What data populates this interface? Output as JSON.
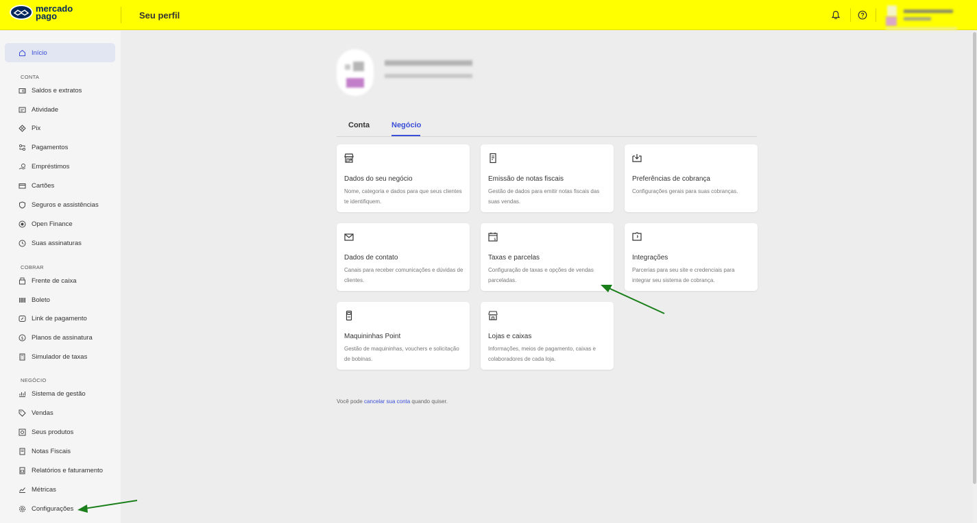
{
  "header": {
    "brand_line1": "mercado",
    "brand_line2": "pago",
    "title": "Seu perfil",
    "icons": [
      "bell-icon",
      "help-icon"
    ],
    "brand_color": "#ffff00"
  },
  "sidebar": {
    "home_label": "Início",
    "sections": [
      {
        "title": "CONTA",
        "items": [
          {
            "label": "Saldos e extratos",
            "icon": "wallet-icon"
          },
          {
            "label": "Atividade",
            "icon": "activity-icon"
          },
          {
            "label": "Pix",
            "icon": "pix-icon"
          },
          {
            "label": "Pagamentos",
            "icon": "payments-icon"
          },
          {
            "label": "Empréstimos",
            "icon": "loan-icon"
          },
          {
            "label": "Cartões",
            "icon": "card-icon"
          },
          {
            "label": "Seguros e assistências",
            "icon": "shield-icon"
          },
          {
            "label": "Open Finance",
            "icon": "open-finance-icon"
          },
          {
            "label": "Suas assinaturas",
            "icon": "subscription-icon"
          }
        ]
      },
      {
        "title": "COBRAR",
        "items": [
          {
            "label": "Frente de caixa",
            "icon": "cashier-icon"
          },
          {
            "label": "Boleto",
            "icon": "barcode-icon"
          },
          {
            "label": "Link de pagamento",
            "icon": "link-icon"
          },
          {
            "label": "Planos de assinatura",
            "icon": "plan-icon"
          },
          {
            "label": "Simulador de taxas",
            "icon": "calculator-icon"
          }
        ]
      },
      {
        "title": "NEGÓCIO",
        "items": [
          {
            "label": "Sistema de gestão",
            "icon": "management-icon"
          },
          {
            "label": "Vendas",
            "icon": "tag-icon"
          },
          {
            "label": "Seus produtos",
            "icon": "products-icon"
          },
          {
            "label": "Notas Fiscais",
            "icon": "invoice-icon"
          },
          {
            "label": "Relatórios e faturamento",
            "icon": "report-icon"
          },
          {
            "label": "Métricas",
            "icon": "metrics-icon"
          },
          {
            "label": "Configurações",
            "icon": "gear-icon"
          }
        ]
      }
    ]
  },
  "tabs": [
    {
      "label": "Conta",
      "active": false
    },
    {
      "label": "Negócio",
      "active": true
    }
  ],
  "cards": [
    {
      "title": "Dados do seu negócio",
      "desc": "Nome, categoria e dados para que seus clientes te identifiquem.",
      "icon": "store-icon"
    },
    {
      "title": "Emissão de notas fiscais",
      "desc": "Gestão de dados para emitir notas fiscais das suas vendas.",
      "icon": "receipt-icon"
    },
    {
      "title": "Preferências de cobrança",
      "desc": "Configurações gerais para suas cobranças.",
      "icon": "download-tray-icon"
    },
    {
      "title": "Dados de contato",
      "desc": "Canais para receber comunicações e dúvidas de clientes.",
      "icon": "envelope-icon"
    },
    {
      "title": "Taxas e parcelas",
      "desc": "Configuração de taxas e opções de vendas parceladas.",
      "icon": "calendar-money-icon"
    },
    {
      "title": "Integrações",
      "desc": "Parcerias para seu site e credenciais para integrar seu sistema de cobrança.",
      "icon": "puzzle-icon"
    },
    {
      "title": "Maquininhas Point",
      "desc": "Gestão de maquininhas, vouchers e solicitação de bobinas.",
      "icon": "pos-terminal-icon"
    },
    {
      "title": "Lojas e caixas",
      "desc": "Informações, meios de pagamento, caixas e colaboradores de cada loja.",
      "icon": "shop-icon"
    }
  ],
  "footer": {
    "prefix": "Você pode ",
    "link": "cancelar sua conta",
    "suffix": " quando quiser."
  },
  "accent_color": "#3a4ed8",
  "annotation_color": "#1a7f1a"
}
